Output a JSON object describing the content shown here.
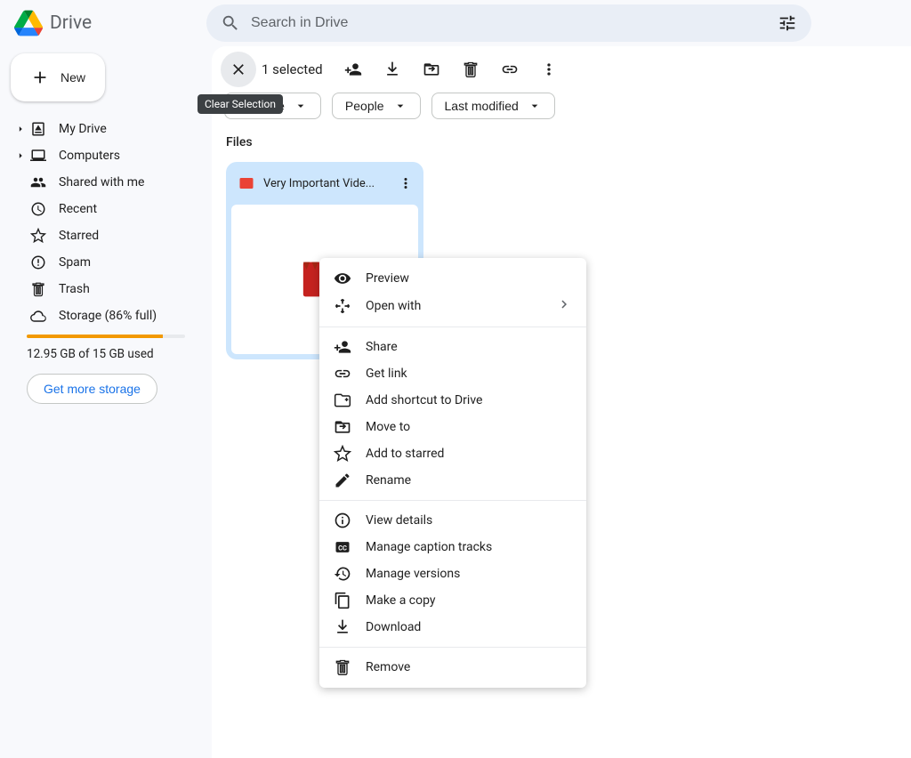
{
  "app": {
    "name": "Drive"
  },
  "search": {
    "placeholder": "Search in Drive"
  },
  "new_button": {
    "label": "New"
  },
  "sidebar": {
    "items": [
      {
        "label": "My Drive"
      },
      {
        "label": "Computers"
      },
      {
        "label": "Shared with me"
      },
      {
        "label": "Recent"
      },
      {
        "label": "Starred"
      },
      {
        "label": "Spam"
      },
      {
        "label": "Trash"
      },
      {
        "label": "Storage (86% full)"
      }
    ],
    "storage": {
      "percent": 86,
      "used_text": "12.95 GB of 15 GB used",
      "upgrade_label": "Get more storage"
    }
  },
  "toolbar": {
    "selection_text": "1 selected",
    "tooltip": "Clear Selection"
  },
  "filters": {
    "file_type": "File type",
    "people": "People",
    "last_modified": "Last modified"
  },
  "sections": {
    "files_label": "Files"
  },
  "files": [
    {
      "name": "Very Important Vide..."
    }
  ],
  "context_menu": {
    "groups": [
      [
        {
          "label": "Preview",
          "icon": "eye",
          "submenu": false
        },
        {
          "label": "Open with",
          "icon": "open",
          "submenu": true
        }
      ],
      [
        {
          "label": "Share",
          "icon": "person-add",
          "submenu": false
        },
        {
          "label": "Get link",
          "icon": "link",
          "submenu": false
        },
        {
          "label": "Add shortcut to Drive",
          "icon": "shortcut",
          "submenu": false
        },
        {
          "label": "Move to",
          "icon": "move",
          "submenu": false
        },
        {
          "label": "Add to starred",
          "icon": "star",
          "submenu": false
        },
        {
          "label": "Rename",
          "icon": "rename",
          "submenu": false
        }
      ],
      [
        {
          "label": "View details",
          "icon": "info",
          "submenu": false
        },
        {
          "label": "Manage caption tracks",
          "icon": "caption",
          "submenu": false
        },
        {
          "label": "Manage versions",
          "icon": "history",
          "submenu": false
        },
        {
          "label": "Make a copy",
          "icon": "copy",
          "submenu": false
        },
        {
          "label": "Download",
          "icon": "download",
          "submenu": false
        }
      ],
      [
        {
          "label": "Remove",
          "icon": "trash",
          "submenu": false
        }
      ]
    ]
  }
}
